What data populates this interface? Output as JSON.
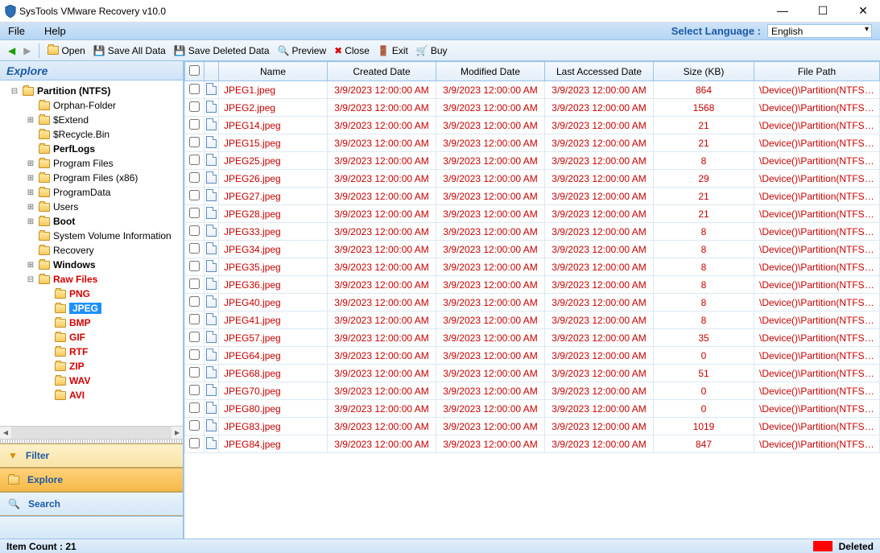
{
  "window": {
    "title": "SysTools VMware Recovery v10.0"
  },
  "menubar": {
    "file": "File",
    "help": "Help",
    "select_language": "Select Language :",
    "language": "English"
  },
  "toolbar": {
    "open": "Open",
    "save_all": "Save All Data",
    "save_deleted": "Save Deleted Data",
    "preview": "Preview",
    "close": "Close",
    "exit": "Exit",
    "buy": "Buy"
  },
  "explore": {
    "header": "Explore",
    "nodes": [
      {
        "indent": 0,
        "toggle": "⊟",
        "label": "Partition (NTFS)",
        "bold": true
      },
      {
        "indent": 1,
        "toggle": "",
        "label": "Orphan-Folder"
      },
      {
        "indent": 1,
        "toggle": "⊞",
        "label": "$Extend"
      },
      {
        "indent": 1,
        "toggle": "",
        "label": "$Recycle.Bin"
      },
      {
        "indent": 1,
        "toggle": "",
        "label": "PerfLogs",
        "bold": true
      },
      {
        "indent": 1,
        "toggle": "⊞",
        "label": "Program Files"
      },
      {
        "indent": 1,
        "toggle": "⊞",
        "label": "Program Files (x86)"
      },
      {
        "indent": 1,
        "toggle": "⊞",
        "label": "ProgramData"
      },
      {
        "indent": 1,
        "toggle": "⊞",
        "label": "Users"
      },
      {
        "indent": 1,
        "toggle": "⊞",
        "label": "Boot",
        "bold": true
      },
      {
        "indent": 1,
        "toggle": "",
        "label": "System Volume Information"
      },
      {
        "indent": 1,
        "toggle": "",
        "label": "Recovery"
      },
      {
        "indent": 1,
        "toggle": "⊞",
        "label": "Windows",
        "bold": true
      },
      {
        "indent": 1,
        "toggle": "⊟",
        "label": "Raw Files",
        "red": true
      },
      {
        "indent": 2,
        "toggle": "",
        "label": "PNG",
        "red": true
      },
      {
        "indent": 2,
        "toggle": "",
        "label": "JPEG",
        "red": true,
        "sel": true
      },
      {
        "indent": 2,
        "toggle": "",
        "label": "BMP",
        "red": true
      },
      {
        "indent": 2,
        "toggle": "",
        "label": "GIF",
        "red": true
      },
      {
        "indent": 2,
        "toggle": "",
        "label": "RTF",
        "red": true
      },
      {
        "indent": 2,
        "toggle": "",
        "label": "ZIP",
        "red": true
      },
      {
        "indent": 2,
        "toggle": "",
        "label": "WAV",
        "red": true
      },
      {
        "indent": 2,
        "toggle": "",
        "label": "AVI",
        "red": true
      }
    ]
  },
  "nav": {
    "filter": "Filter",
    "explore": "Explore",
    "search": "Search"
  },
  "table": {
    "cols": [
      "",
      "Name",
      "Created Date",
      "Modified Date",
      "Last Accessed Date",
      "Size (KB)",
      "File Path"
    ],
    "rows": [
      {
        "name": "JPEG1.jpeg",
        "created": "3/9/2023 12:00:00 AM",
        "modified": "3/9/2023 12:00:00 AM",
        "accessed": "3/9/2023 12:00:00 AM",
        "size": "864",
        "path": "\\Device()\\Partition(NTFS)..."
      },
      {
        "name": "JPEG2.jpeg",
        "created": "3/9/2023 12:00:00 AM",
        "modified": "3/9/2023 12:00:00 AM",
        "accessed": "3/9/2023 12:00:00 AM",
        "size": "1568",
        "path": "\\Device()\\Partition(NTFS)..."
      },
      {
        "name": "JPEG14.jpeg",
        "created": "3/9/2023 12:00:00 AM",
        "modified": "3/9/2023 12:00:00 AM",
        "accessed": "3/9/2023 12:00:00 AM",
        "size": "21",
        "path": "\\Device()\\Partition(NTFS)..."
      },
      {
        "name": "JPEG15.jpeg",
        "created": "3/9/2023 12:00:00 AM",
        "modified": "3/9/2023 12:00:00 AM",
        "accessed": "3/9/2023 12:00:00 AM",
        "size": "21",
        "path": "\\Device()\\Partition(NTFS)..."
      },
      {
        "name": "JPEG25.jpeg",
        "created": "3/9/2023 12:00:00 AM",
        "modified": "3/9/2023 12:00:00 AM",
        "accessed": "3/9/2023 12:00:00 AM",
        "size": "8",
        "path": "\\Device()\\Partition(NTFS)..."
      },
      {
        "name": "JPEG26.jpeg",
        "created": "3/9/2023 12:00:00 AM",
        "modified": "3/9/2023 12:00:00 AM",
        "accessed": "3/9/2023 12:00:00 AM",
        "size": "29",
        "path": "\\Device()\\Partition(NTFS)..."
      },
      {
        "name": "JPEG27.jpeg",
        "created": "3/9/2023 12:00:00 AM",
        "modified": "3/9/2023 12:00:00 AM",
        "accessed": "3/9/2023 12:00:00 AM",
        "size": "21",
        "path": "\\Device()\\Partition(NTFS)..."
      },
      {
        "name": "JPEG28.jpeg",
        "created": "3/9/2023 12:00:00 AM",
        "modified": "3/9/2023 12:00:00 AM",
        "accessed": "3/9/2023 12:00:00 AM",
        "size": "21",
        "path": "\\Device()\\Partition(NTFS)..."
      },
      {
        "name": "JPEG33.jpeg",
        "created": "3/9/2023 12:00:00 AM",
        "modified": "3/9/2023 12:00:00 AM",
        "accessed": "3/9/2023 12:00:00 AM",
        "size": "8",
        "path": "\\Device()\\Partition(NTFS)..."
      },
      {
        "name": "JPEG34.jpeg",
        "created": "3/9/2023 12:00:00 AM",
        "modified": "3/9/2023 12:00:00 AM",
        "accessed": "3/9/2023 12:00:00 AM",
        "size": "8",
        "path": "\\Device()\\Partition(NTFS)..."
      },
      {
        "name": "JPEG35.jpeg",
        "created": "3/9/2023 12:00:00 AM",
        "modified": "3/9/2023 12:00:00 AM",
        "accessed": "3/9/2023 12:00:00 AM",
        "size": "8",
        "path": "\\Device()\\Partition(NTFS)..."
      },
      {
        "name": "JPEG36.jpeg",
        "created": "3/9/2023 12:00:00 AM",
        "modified": "3/9/2023 12:00:00 AM",
        "accessed": "3/9/2023 12:00:00 AM",
        "size": "8",
        "path": "\\Device()\\Partition(NTFS)..."
      },
      {
        "name": "JPEG40.jpeg",
        "created": "3/9/2023 12:00:00 AM",
        "modified": "3/9/2023 12:00:00 AM",
        "accessed": "3/9/2023 12:00:00 AM",
        "size": "8",
        "path": "\\Device()\\Partition(NTFS)..."
      },
      {
        "name": "JPEG41.jpeg",
        "created": "3/9/2023 12:00:00 AM",
        "modified": "3/9/2023 12:00:00 AM",
        "accessed": "3/9/2023 12:00:00 AM",
        "size": "8",
        "path": "\\Device()\\Partition(NTFS)..."
      },
      {
        "name": "JPEG57.jpeg",
        "created": "3/9/2023 12:00:00 AM",
        "modified": "3/9/2023 12:00:00 AM",
        "accessed": "3/9/2023 12:00:00 AM",
        "size": "35",
        "path": "\\Device()\\Partition(NTFS)..."
      },
      {
        "name": "JPEG64.jpeg",
        "created": "3/9/2023 12:00:00 AM",
        "modified": "3/9/2023 12:00:00 AM",
        "accessed": "3/9/2023 12:00:00 AM",
        "size": "0",
        "path": "\\Device()\\Partition(NTFS)..."
      },
      {
        "name": "JPEG68.jpeg",
        "created": "3/9/2023 12:00:00 AM",
        "modified": "3/9/2023 12:00:00 AM",
        "accessed": "3/9/2023 12:00:00 AM",
        "size": "51",
        "path": "\\Device()\\Partition(NTFS)..."
      },
      {
        "name": "JPEG70.jpeg",
        "created": "3/9/2023 12:00:00 AM",
        "modified": "3/9/2023 12:00:00 AM",
        "accessed": "3/9/2023 12:00:00 AM",
        "size": "0",
        "path": "\\Device()\\Partition(NTFS)..."
      },
      {
        "name": "JPEG80.jpeg",
        "created": "3/9/2023 12:00:00 AM",
        "modified": "3/9/2023 12:00:00 AM",
        "accessed": "3/9/2023 12:00:00 AM",
        "size": "0",
        "path": "\\Device()\\Partition(NTFS)..."
      },
      {
        "name": "JPEG83.jpeg",
        "created": "3/9/2023 12:00:00 AM",
        "modified": "3/9/2023 12:00:00 AM",
        "accessed": "3/9/2023 12:00:00 AM",
        "size": "1019",
        "path": "\\Device()\\Partition(NTFS)..."
      },
      {
        "name": "JPEG84.jpeg",
        "created": "3/9/2023 12:00:00 AM",
        "modified": "3/9/2023 12:00:00 AM",
        "accessed": "3/9/2023 12:00:00 AM",
        "size": "847",
        "path": "\\Device()\\Partition(NTFS)..."
      }
    ]
  },
  "status": {
    "item_count": "Item Count : 21",
    "deleted": "Deleted"
  }
}
